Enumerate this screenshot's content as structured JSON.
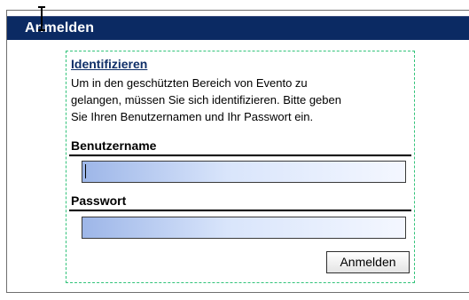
{
  "header": {
    "title": "Anmelden"
  },
  "login": {
    "section_title": "Identifizieren",
    "intro_lines": [
      "Um in den geschützten Bereich von Evento zu",
      "gelangen, müssen Sie sich identifizieren. Bitte geben",
      "Sie Ihren Benutzernamen und Ihr Passwort ein."
    ],
    "username_label": "Benutzername",
    "username_value": "",
    "password_label": "Passwort",
    "password_value": "",
    "submit_label": "Anmelden"
  },
  "colors": {
    "header_background": "#0b2a63",
    "section_title": "#0f2f68",
    "field_gradient_left": "#9db6e8",
    "field_gradient_right": "#f4f7ff",
    "dashed_outline": "#32c37a"
  }
}
